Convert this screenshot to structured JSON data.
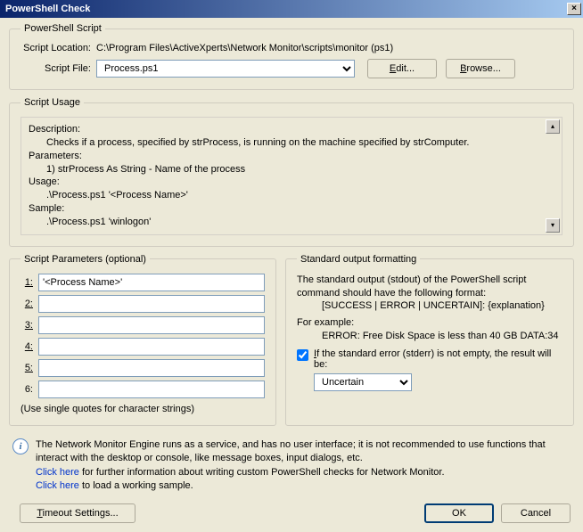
{
  "title": "PowerShell Check",
  "script_section": {
    "legend": "PowerShell Script",
    "location_label": "Script Location:",
    "location_value": "C:\\Program Files\\ActiveXperts\\Network Monitor\\scripts\\monitor (ps1)",
    "file_label": "Script File:",
    "file_value": "Process.ps1",
    "edit_btn": "Edit...",
    "browse_btn": "Browse..."
  },
  "usage": {
    "legend": "Script Usage",
    "desc_heading": "Description:",
    "desc_text": "Checks if a process, specified by strProcess, is running on the machine specified by strComputer.",
    "params_heading": "Parameters:",
    "params_text": "1) strProcess As String - Name of the process",
    "usage_heading": "Usage:",
    "usage_text": ".\\Process.ps1 '<Process Name>'",
    "sample_heading": "Sample:",
    "sample_text": ".\\Process.ps1 'winlogon'"
  },
  "params": {
    "legend": "Script Parameters (optional)",
    "labels": [
      "1:",
      "2:",
      "3:",
      "4:",
      "5:",
      "6:"
    ],
    "values": [
      "'<Process Name>'",
      "",
      "",
      "",
      "",
      ""
    ],
    "hint": "(Use single quotes for character strings)"
  },
  "stdout": {
    "legend": "Standard output formatting",
    "line1": "The standard output (stdout) of the PowerShell script command should have the following format:",
    "line1_fmt": "[SUCCESS | ERROR | UNCERTAIN]: {explanation}",
    "line2": "For example:",
    "line2_ex": "ERROR: Free Disk Space is less than 40 GB DATA:34",
    "chk_label": "If the standard error (stderr) is not empty, the result will be:",
    "select_value": "Uncertain"
  },
  "info": {
    "text1": "The Network Monitor Engine runs as a service, and has no user interface; it is not recommended to use functions that interact with the desktop or console, like message boxes, input dialogs, etc.",
    "link1": "Click here",
    "link1_after": " for further information about writing custom PowerShell checks for Network Monitor.",
    "link2": "Click here",
    "link2_after": " to load a working sample."
  },
  "buttons": {
    "timeout": "Timeout Settings...",
    "ok": "OK",
    "cancel": "Cancel"
  }
}
